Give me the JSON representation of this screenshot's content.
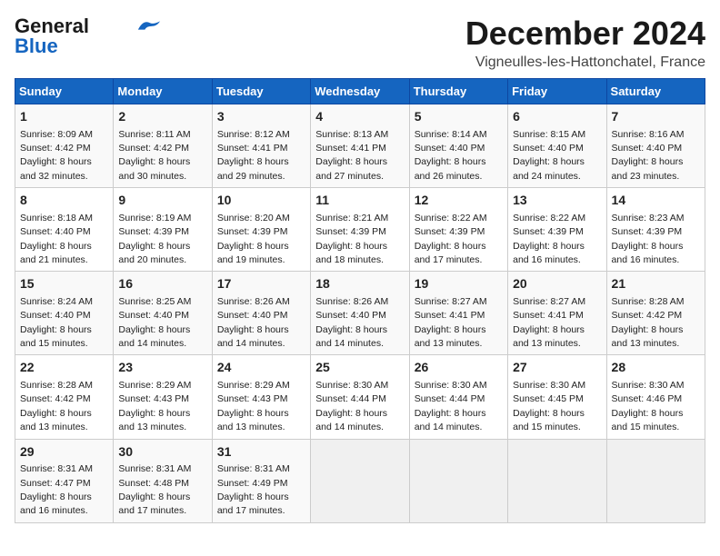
{
  "logo": {
    "general": "General",
    "blue": "Blue"
  },
  "header": {
    "month": "December 2024",
    "location": "Vigneulles-les-Hattonchatel, France"
  },
  "weekdays": [
    "Sunday",
    "Monday",
    "Tuesday",
    "Wednesday",
    "Thursday",
    "Friday",
    "Saturday"
  ],
  "weeks": [
    [
      {
        "day": "1",
        "info": "Sunrise: 8:09 AM\nSunset: 4:42 PM\nDaylight: 8 hours\nand 32 minutes."
      },
      {
        "day": "2",
        "info": "Sunrise: 8:11 AM\nSunset: 4:42 PM\nDaylight: 8 hours\nand 30 minutes."
      },
      {
        "day": "3",
        "info": "Sunrise: 8:12 AM\nSunset: 4:41 PM\nDaylight: 8 hours\nand 29 minutes."
      },
      {
        "day": "4",
        "info": "Sunrise: 8:13 AM\nSunset: 4:41 PM\nDaylight: 8 hours\nand 27 minutes."
      },
      {
        "day": "5",
        "info": "Sunrise: 8:14 AM\nSunset: 4:40 PM\nDaylight: 8 hours\nand 26 minutes."
      },
      {
        "day": "6",
        "info": "Sunrise: 8:15 AM\nSunset: 4:40 PM\nDaylight: 8 hours\nand 24 minutes."
      },
      {
        "day": "7",
        "info": "Sunrise: 8:16 AM\nSunset: 4:40 PM\nDaylight: 8 hours\nand 23 minutes."
      }
    ],
    [
      {
        "day": "8",
        "info": "Sunrise: 8:18 AM\nSunset: 4:40 PM\nDaylight: 8 hours\nand 21 minutes."
      },
      {
        "day": "9",
        "info": "Sunrise: 8:19 AM\nSunset: 4:39 PM\nDaylight: 8 hours\nand 20 minutes."
      },
      {
        "day": "10",
        "info": "Sunrise: 8:20 AM\nSunset: 4:39 PM\nDaylight: 8 hours\nand 19 minutes."
      },
      {
        "day": "11",
        "info": "Sunrise: 8:21 AM\nSunset: 4:39 PM\nDaylight: 8 hours\nand 18 minutes."
      },
      {
        "day": "12",
        "info": "Sunrise: 8:22 AM\nSunset: 4:39 PM\nDaylight: 8 hours\nand 17 minutes."
      },
      {
        "day": "13",
        "info": "Sunrise: 8:22 AM\nSunset: 4:39 PM\nDaylight: 8 hours\nand 16 minutes."
      },
      {
        "day": "14",
        "info": "Sunrise: 8:23 AM\nSunset: 4:39 PM\nDaylight: 8 hours\nand 16 minutes."
      }
    ],
    [
      {
        "day": "15",
        "info": "Sunrise: 8:24 AM\nSunset: 4:40 PM\nDaylight: 8 hours\nand 15 minutes."
      },
      {
        "day": "16",
        "info": "Sunrise: 8:25 AM\nSunset: 4:40 PM\nDaylight: 8 hours\nand 14 minutes."
      },
      {
        "day": "17",
        "info": "Sunrise: 8:26 AM\nSunset: 4:40 PM\nDaylight: 8 hours\nand 14 minutes."
      },
      {
        "day": "18",
        "info": "Sunrise: 8:26 AM\nSunset: 4:40 PM\nDaylight: 8 hours\nand 14 minutes."
      },
      {
        "day": "19",
        "info": "Sunrise: 8:27 AM\nSunset: 4:41 PM\nDaylight: 8 hours\nand 13 minutes."
      },
      {
        "day": "20",
        "info": "Sunrise: 8:27 AM\nSunset: 4:41 PM\nDaylight: 8 hours\nand 13 minutes."
      },
      {
        "day": "21",
        "info": "Sunrise: 8:28 AM\nSunset: 4:42 PM\nDaylight: 8 hours\nand 13 minutes."
      }
    ],
    [
      {
        "day": "22",
        "info": "Sunrise: 8:28 AM\nSunset: 4:42 PM\nDaylight: 8 hours\nand 13 minutes."
      },
      {
        "day": "23",
        "info": "Sunrise: 8:29 AM\nSunset: 4:43 PM\nDaylight: 8 hours\nand 13 minutes."
      },
      {
        "day": "24",
        "info": "Sunrise: 8:29 AM\nSunset: 4:43 PM\nDaylight: 8 hours\nand 13 minutes."
      },
      {
        "day": "25",
        "info": "Sunrise: 8:30 AM\nSunset: 4:44 PM\nDaylight: 8 hours\nand 14 minutes."
      },
      {
        "day": "26",
        "info": "Sunrise: 8:30 AM\nSunset: 4:44 PM\nDaylight: 8 hours\nand 14 minutes."
      },
      {
        "day": "27",
        "info": "Sunrise: 8:30 AM\nSunset: 4:45 PM\nDaylight: 8 hours\nand 15 minutes."
      },
      {
        "day": "28",
        "info": "Sunrise: 8:30 AM\nSunset: 4:46 PM\nDaylight: 8 hours\nand 15 minutes."
      }
    ],
    [
      {
        "day": "29",
        "info": "Sunrise: 8:31 AM\nSunset: 4:47 PM\nDaylight: 8 hours\nand 16 minutes."
      },
      {
        "day": "30",
        "info": "Sunrise: 8:31 AM\nSunset: 4:48 PM\nDaylight: 8 hours\nand 17 minutes."
      },
      {
        "day": "31",
        "info": "Sunrise: 8:31 AM\nSunset: 4:49 PM\nDaylight: 8 hours\nand 17 minutes."
      },
      null,
      null,
      null,
      null
    ]
  ]
}
